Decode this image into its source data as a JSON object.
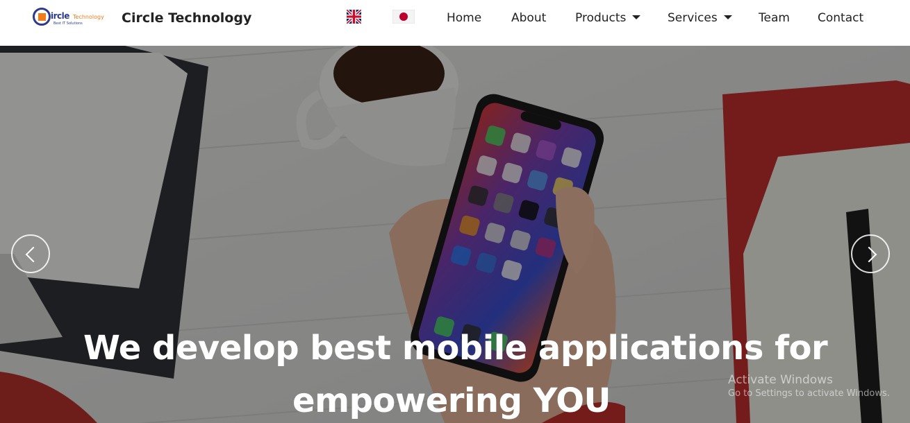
{
  "header": {
    "logo_text": "ircle",
    "logo_suffix": "Technology",
    "logo_tagline": "Best IT Solutions",
    "brand_name": "Circle Technology",
    "languages": [
      {
        "name": "English",
        "icon": "uk-flag-icon"
      },
      {
        "name": "Japanese",
        "icon": "japan-flag-icon"
      }
    ]
  },
  "nav": {
    "home": "Home",
    "about": "About",
    "products": "Products",
    "services": "Services",
    "team": "Team",
    "contact": "Contact"
  },
  "hero": {
    "headline_line1": "We develop best mobile applications for",
    "headline_line2": "empowering YOU",
    "prev_icon": "chevron-left-icon",
    "next_icon": "chevron-right-icon"
  },
  "watermark": {
    "title": "Activate Windows",
    "subtitle": "Go to Settings to activate Windows."
  },
  "colors": {
    "brand_blue": "#2b3a8f",
    "brand_orange": "#f07c1a",
    "text_dark": "#222222",
    "overlay": "rgba(0,0,0,0.4)"
  }
}
